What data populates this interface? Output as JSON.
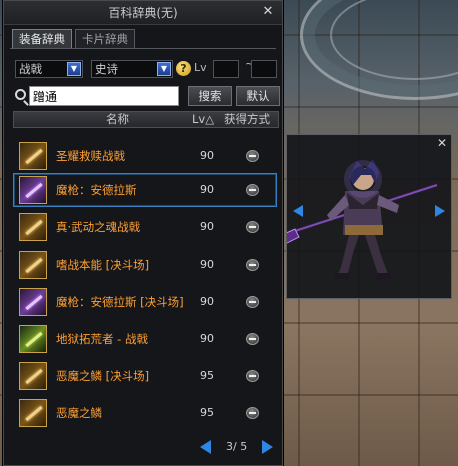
{
  "window": {
    "title": "百科辞典(无)",
    "close_glyph": "✕"
  },
  "tabs": [
    {
      "label": "装备辞典",
      "active": true
    },
    {
      "label": "卡片辞典",
      "active": false
    }
  ],
  "filters": {
    "category": "战戟",
    "rarity": "史诗",
    "help_glyph": "?",
    "lv_label": "Lv",
    "lv_min": "",
    "lv_max": "",
    "lv_sep": "~"
  },
  "search": {
    "value": "蹭通",
    "search_button": "搜索",
    "default_button": "默认"
  },
  "table": {
    "col_name": "名称",
    "col_lv": "Lv△",
    "col_how": "获得方式"
  },
  "items": [
    {
      "name": "圣耀救赎战戟",
      "lv": "90",
      "icon": "gold-halberd-icon"
    },
    {
      "name": "魔枪：安德拉斯",
      "lv": "90",
      "icon": "purple-lance-icon",
      "selected": true
    },
    {
      "name": "真·武动之魂战戟",
      "lv": "90",
      "icon": "gold-halberd-icon"
    },
    {
      "name": "嗜战本能 [决斗场]",
      "lv": "90",
      "icon": "gold-halberd-icon"
    },
    {
      "name": "魔枪：安德拉斯 [决斗场]",
      "lv": "90",
      "icon": "purple-lance-icon"
    },
    {
      "name": "地狱拓荒者 - 战戟",
      "lv": "90",
      "icon": "green-halberd-icon"
    },
    {
      "name": "恶魔之鳞 [决斗场]",
      "lv": "95",
      "icon": "gold-halberd-icon"
    },
    {
      "name": "恶魔之鳞",
      "lv": "95",
      "icon": "gold-halberd-icon"
    }
  ],
  "pager": {
    "text": "3/ 5",
    "current": 3,
    "total": 5
  },
  "preview": {
    "close_glyph": "✕"
  },
  "colors": {
    "item_name": "#ff9f33",
    "accent_blue": "#2f86e3",
    "selected_border": "#3b7fbf"
  }
}
